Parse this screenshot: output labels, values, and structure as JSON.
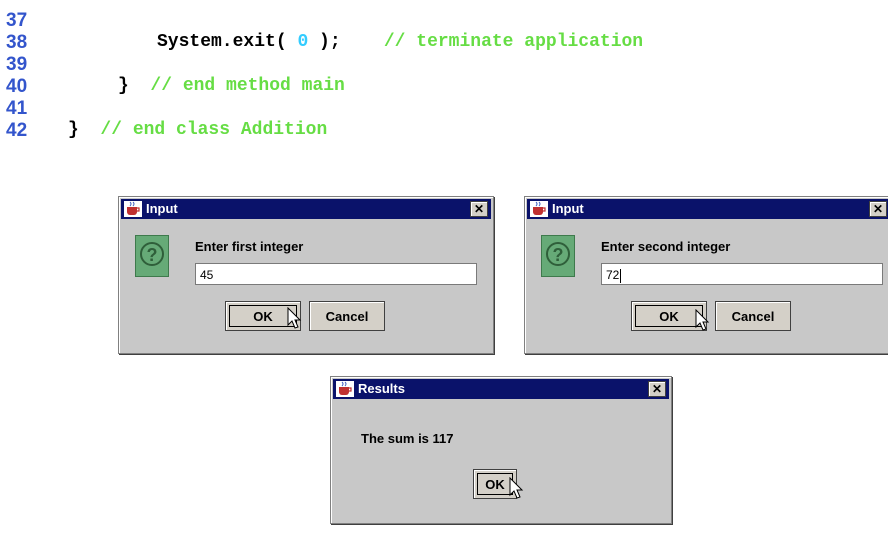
{
  "code": [
    {
      "num": "37",
      "indent": "",
      "parts": []
    },
    {
      "num": "38",
      "indent": "         ",
      "parts": [
        {
          "cls": "kw",
          "text": "System.exit( "
        },
        {
          "cls": "num",
          "text": "0"
        },
        {
          "cls": "kw",
          "text": " );"
        },
        {
          "cls": "cm",
          "text": "    // terminate application"
        }
      ]
    },
    {
      "num": "39",
      "indent": "",
      "parts": []
    },
    {
      "num": "40",
      "indent": "    ",
      "parts": [
        {
          "cls": "kw",
          "text": "}"
        },
        {
          "cls": "cm",
          "text": "  // end method main"
        }
      ]
    },
    {
      "num": "41",
      "indent": "",
      "parts": []
    },
    {
      "num": "42",
      "indent": "",
      "parts": [
        {
          "cls": "kw",
          "text": "}"
        },
        {
          "cls": "cm",
          "text": "  // end class Addition"
        }
      ]
    }
  ],
  "dialog1": {
    "title": "Input",
    "prompt": "Enter first integer",
    "value": "45",
    "ok": "OK",
    "cancel": "Cancel",
    "close": "✕"
  },
  "dialog2": {
    "title": "Input",
    "prompt": "Enter second integer",
    "value": "72",
    "ok": "OK",
    "cancel": "Cancel",
    "close": "✕"
  },
  "dialog3": {
    "title": "Results",
    "message": "The sum is 117",
    "ok": "OK",
    "close": "✕"
  },
  "colors": {
    "line_numbers": "#3355cc",
    "keyword": "#000000",
    "literal": "#33ccff",
    "comment": "#66dd44",
    "titlebar": "#0a126a",
    "dialog_bg": "#c8c8c8"
  }
}
